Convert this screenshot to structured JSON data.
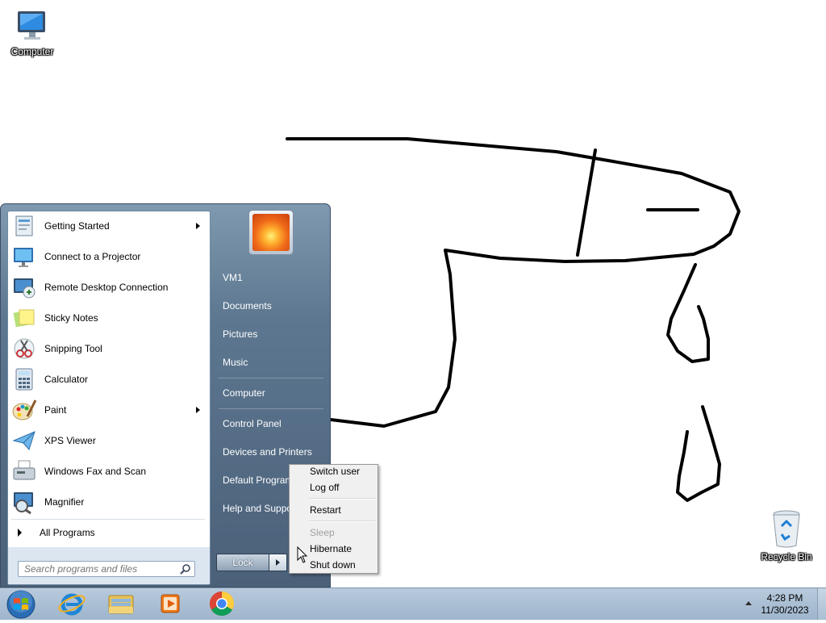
{
  "desktop": {
    "icons": [
      {
        "label": "Computer",
        "icon": "computer-icon"
      },
      {
        "label": "Recycle Bin",
        "icon": "recycle-bin-icon"
      }
    ]
  },
  "start_menu": {
    "programs": [
      {
        "label": "Getting Started",
        "icon": "getting-started-icon",
        "has_submenu": true
      },
      {
        "label": "Connect to a Projector",
        "icon": "projector-icon",
        "has_submenu": false
      },
      {
        "label": "Remote Desktop Connection",
        "icon": "remote-desktop-icon",
        "has_submenu": false
      },
      {
        "label": "Sticky Notes",
        "icon": "sticky-notes-icon",
        "has_submenu": false
      },
      {
        "label": "Snipping Tool",
        "icon": "snipping-tool-icon",
        "has_submenu": false
      },
      {
        "label": "Calculator",
        "icon": "calculator-icon",
        "has_submenu": false
      },
      {
        "label": "Paint",
        "icon": "paint-icon",
        "has_submenu": true
      },
      {
        "label": "XPS Viewer",
        "icon": "xps-viewer-icon",
        "has_submenu": false
      },
      {
        "label": "Windows Fax and Scan",
        "icon": "fax-scan-icon",
        "has_submenu": false
      },
      {
        "label": "Magnifier",
        "icon": "magnifier-icon",
        "has_submenu": false
      }
    ],
    "all_programs": "All Programs",
    "search": {
      "placeholder": "Search programs and files",
      "icon": "search-icon"
    },
    "user_picture": "flower-avatar-icon",
    "right_links": [
      "VM1",
      "Documents",
      "Pictures",
      "Music",
      "Computer",
      "Control Panel",
      "Devices and Printers",
      "Default Programs",
      "Help and Support"
    ],
    "lock_label": "Lock"
  },
  "power_menu": {
    "items": [
      "Switch user",
      "Log off",
      "Restart",
      "Sleep",
      "Hibernate",
      "Shut down"
    ],
    "disabled": [
      "Sleep"
    ]
  },
  "taskbar": {
    "pinned": [
      {
        "name": "start-orb",
        "icon": "windows-orb-icon"
      },
      {
        "name": "internet-explorer",
        "icon": "internet-explorer-icon"
      },
      {
        "name": "windows-explorer",
        "icon": "folder-icon"
      },
      {
        "name": "media-player",
        "icon": "media-player-icon"
      },
      {
        "name": "chrome",
        "icon": "chrome-icon"
      }
    ],
    "clock": {
      "time": "4:28 PM",
      "date": "11/30/2023"
    }
  },
  "colors": {
    "start_menu_right": "#5d7790",
    "taskbar": "#aabfd3",
    "scribble": "#000000"
  }
}
